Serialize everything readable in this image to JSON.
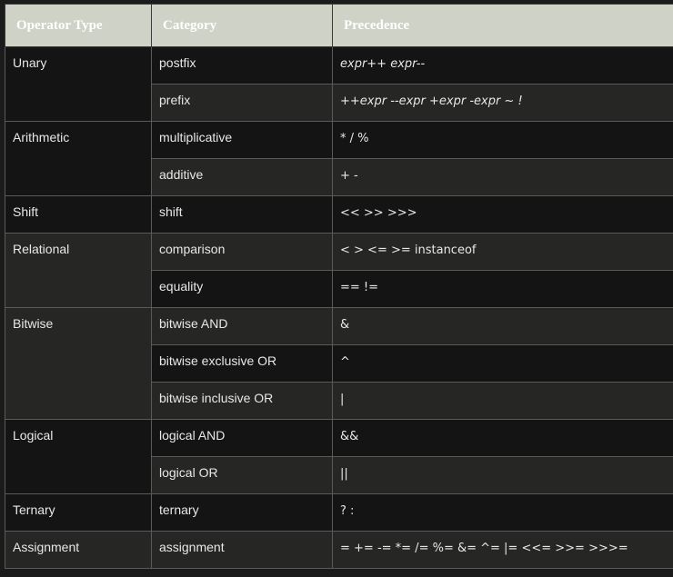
{
  "headers": [
    "Operator Type",
    "Category",
    "Precedence"
  ],
  "rows": [
    {
      "type": "Unary",
      "category": "postfix",
      "precedence": "expr++ expr--"
    },
    {
      "category": "prefix",
      "precedence": "++expr --expr +expr -expr ~ !"
    },
    {
      "type": "Arithmetic",
      "category": "multiplicative",
      "precedence": "* / %"
    },
    {
      "category": "additive",
      "precedence": "+ -"
    },
    {
      "type": "Shift",
      "category": "shift",
      "precedence": "<< >> >>>"
    },
    {
      "type": "Relational",
      "category": "comparison",
      "precedence": "< > <= >= instanceof"
    },
    {
      "category": "equality",
      "precedence": "== !="
    },
    {
      "type": "Bitwise",
      "category": "bitwise AND",
      "precedence": "&"
    },
    {
      "category": "bitwise exclusive OR",
      "precedence": "^"
    },
    {
      "category": "bitwise inclusive OR",
      "precedence": "|"
    },
    {
      "type": "Logical",
      "category": "logical AND",
      "precedence": "&&"
    },
    {
      "category": "logical OR",
      "precedence": "||"
    },
    {
      "type": "Ternary",
      "category": "ternary",
      "precedence": "? :"
    },
    {
      "type": "Assignment",
      "category": "assignment",
      "precedence": "= += -= *= /= %= &= ^= |= <<= >>= >>>="
    }
  ],
  "colors": {
    "header_bg": "#cfd2c6",
    "row_dark": "#141414",
    "row_light": "#262724",
    "border": "#5a5a5a"
  }
}
